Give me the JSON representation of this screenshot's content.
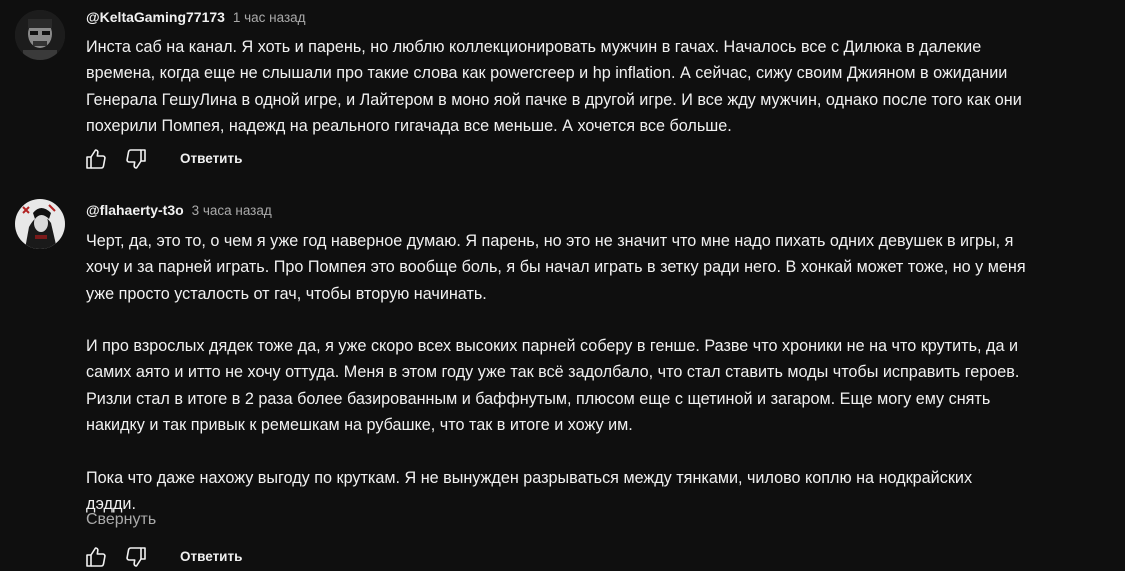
{
  "comments": [
    {
      "author": "@KeltaGaming77173",
      "time": "1 час назад",
      "paragraphs": [
        [
          "Инста саб на канал. Я хоть и парень, но люблю коллекционировать мужчин в гачах. Началось все с Дилюка в далекие",
          "времена, когда еще не слышали про такие слова как powercreep и hp inflation. А сейчас, сижу своим Джияном в ожидании",
          "Генерала ГешуЛина в одной игре, и Лайтером в моно яой пачке в другой игре. И все жду мужчин, однако после того как они",
          "похерили Помпея, надежд на реального гигачада все меньше. А хочется все больше."
        ]
      ],
      "reply_label": "Ответить"
    },
    {
      "author": "@flahaerty-t3o",
      "time": "3 часа назад",
      "paragraphs": [
        [
          "Черт, да, это то, о чем я уже год наверное думаю. Я парень, но это не значит что мне надо пихать одних девушек в игры, я",
          "хочу и за парней играть. Про Помпея это вообще боль, я бы начал играть в зетку ради него. В хонкай может тоже, но у меня",
          "уже просто усталость от гач, чтобы вторую начинать."
        ],
        [
          "И про взрослых дядек тоже да, я уже скоро всех высоких парней соберу в генше. Разве что хроники не на что крутить, да и",
          "самих аято и итто не хочу оттуда. Меня в этом году уже так всё задолбало, что стал ставить моды чтобы исправить героев.",
          "Ризли стал в итоге в 2 раза более базированным и баффнутым, плюсом еще с щетиной и загаром. Еще могу ему снять",
          "накидку и так привык к ремешкам на рубашке, что так в итоге и хожу им."
        ],
        [
          "Пока что даже нахожу выгоду по круткам. Я не вынужден разрываться между тянками, чилово коплю на нодкрайских",
          "дэдди."
        ]
      ],
      "collapse_label": "Свернуть",
      "reply_label": "Ответить"
    }
  ],
  "icons": {
    "like": "thumbs-up-icon",
    "dislike": "thumbs-down-icon"
  },
  "colors": {
    "background": "#0f0f0f",
    "text": "#f1f1f1",
    "secondary_text": "#aaaaaa"
  }
}
